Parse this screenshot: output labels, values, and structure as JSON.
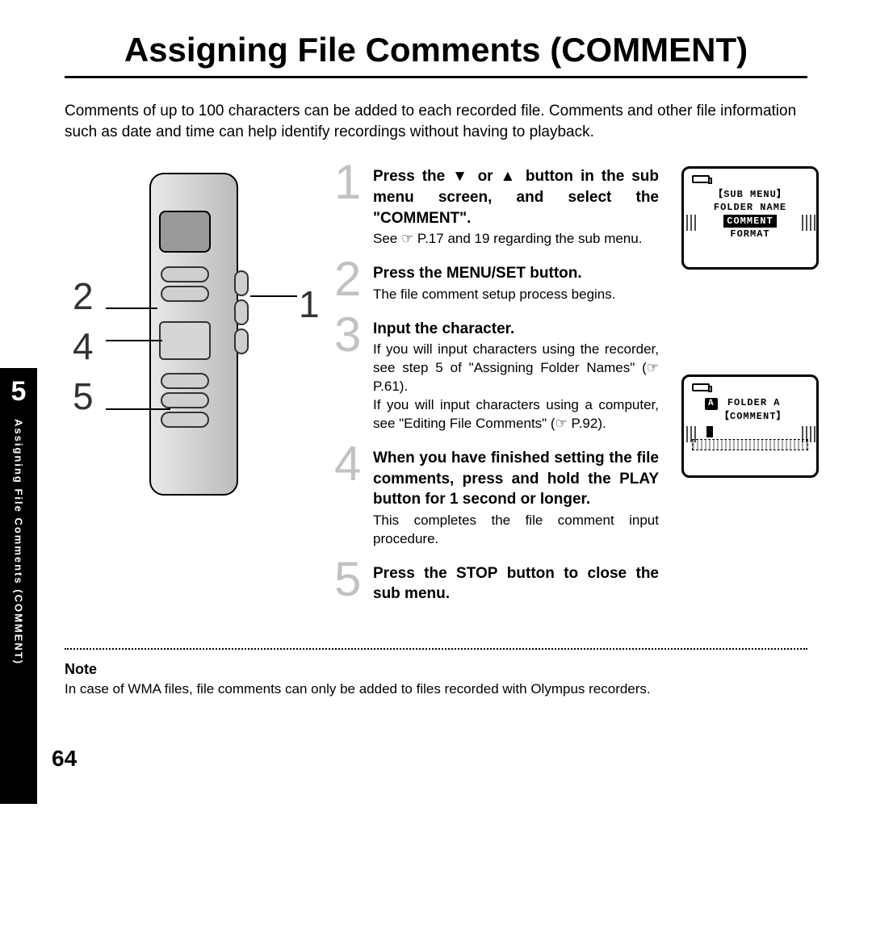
{
  "title": "Assigning File Comments (COMMENT)",
  "intro": "Comments of up to 100 characters can be added to each recorded file. Comments and other file information such as date and time can help identify recordings without having to playback.",
  "chapter": {
    "number": "5",
    "label": "Assigning File Comments (COMMENT)"
  },
  "device_callouts": {
    "left": [
      "2",
      "4",
      "5"
    ],
    "right": [
      "1"
    ]
  },
  "steps": [
    {
      "num": "1",
      "title_pre": "Press the ",
      "title_mid_a": " or ",
      "title_post": " button in the sub menu screen, and select the \"COMMENT\".",
      "body": "See ☞ P.17 and 19 regarding the sub menu."
    },
    {
      "num": "2",
      "title_pre": "Press the ",
      "title_strong": "MENU/SET",
      "title_post": " button.",
      "body": "The file comment setup process begins."
    },
    {
      "num": "3",
      "title": "Input the character.",
      "body": "If you will input characters using the recorder, see step 5 of \"Assigning Folder Names\" (☞ P.61).\nIf you will input characters using a computer, see \"Editing File Comments\" (☞ P.92)."
    },
    {
      "num": "4",
      "title_pre": "When you have finished setting the file comments, press and hold the ",
      "title_strong": "PLAY",
      "title_post": " button for 1 second or longer.",
      "body": "This completes the file comment input procedure."
    },
    {
      "num": "5",
      "title_pre": "Press the ",
      "title_strong": "STOP",
      "title_post": " button to close the sub menu.",
      "body": ""
    }
  ],
  "lcd1": {
    "heading": "【SUB MENU】",
    "line1": "FOLDER NAME",
    "highlight": "COMMENT",
    "line3": "FORMAT"
  },
  "lcd2": {
    "folder_icon": "A",
    "folder_line": "FOLDER A",
    "comment_line": "【COMMENT】"
  },
  "note": {
    "heading": "Note",
    "body": "In case of WMA files, file comments can only be added to files recorded with Olympus recorders."
  },
  "page_number": "64"
}
